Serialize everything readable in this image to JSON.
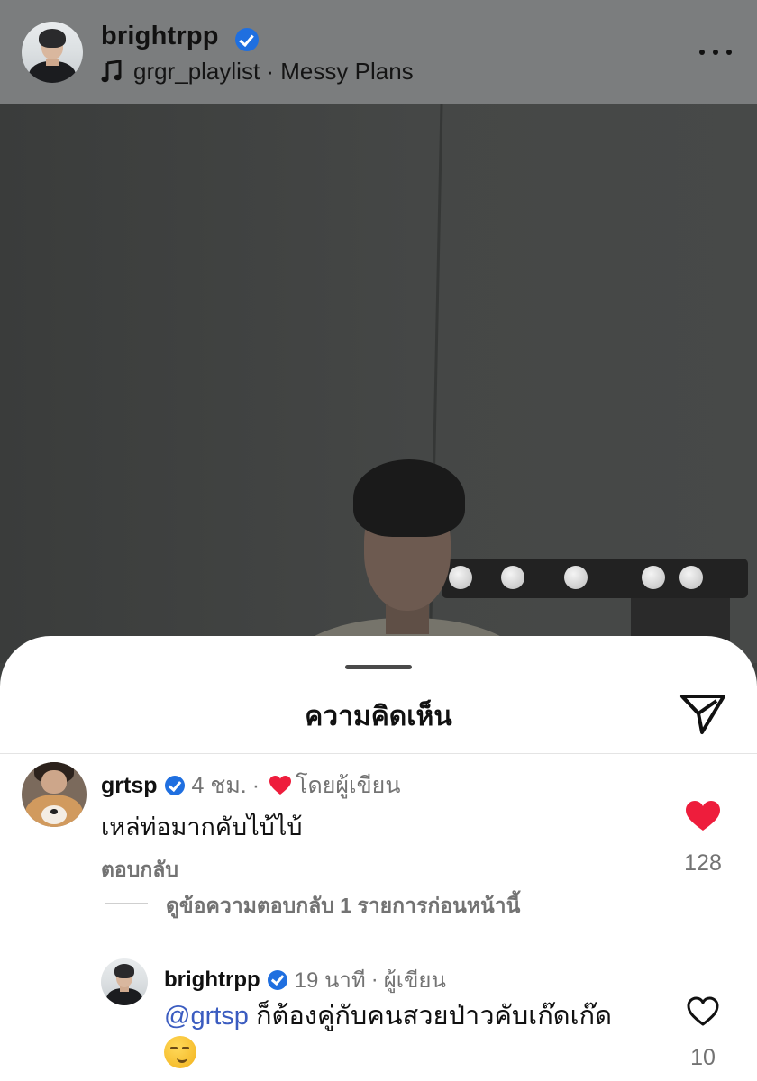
{
  "header": {
    "username": "brightrpp",
    "music_text": "grgr_playlist · Messy Plans",
    "verified_icon": "verified-badge-icon",
    "music_icon": "music-note-icon",
    "more_icon": "more-horizontal-icon"
  },
  "comments_sheet": {
    "title": "ความคิดเห็น",
    "share_icon": "paper-plane-icon",
    "comments": [
      {
        "username": "grtsp",
        "time": "4 ชม.",
        "separator": "·",
        "liked_by_author": "โดยผู้เขียน",
        "text": "เหล่ท่อมากคับไบ้ไบ้",
        "reply_label": "ตอบกลับ",
        "likes": "128",
        "liked": true,
        "view_replies": "ดูข้อความตอบกลับ 1 รายการก่อนหน้านี้"
      },
      {
        "username": "brightrpp",
        "time": "19 นาที",
        "separator": "·",
        "author_label": "ผู้เขียน",
        "mention": "@grtsp",
        "text": "ก็ต้องคู่กับคนสวยป่าวคับเก๊ดเก๊ด",
        "emoji": "smirking-face-emoji",
        "likes": "10",
        "liked": false
      }
    ]
  },
  "colors": {
    "verified": "#1f6fe0",
    "like_red": "#ee1d3c",
    "mention": "#3b5cc0",
    "muted_text": "#737373"
  }
}
